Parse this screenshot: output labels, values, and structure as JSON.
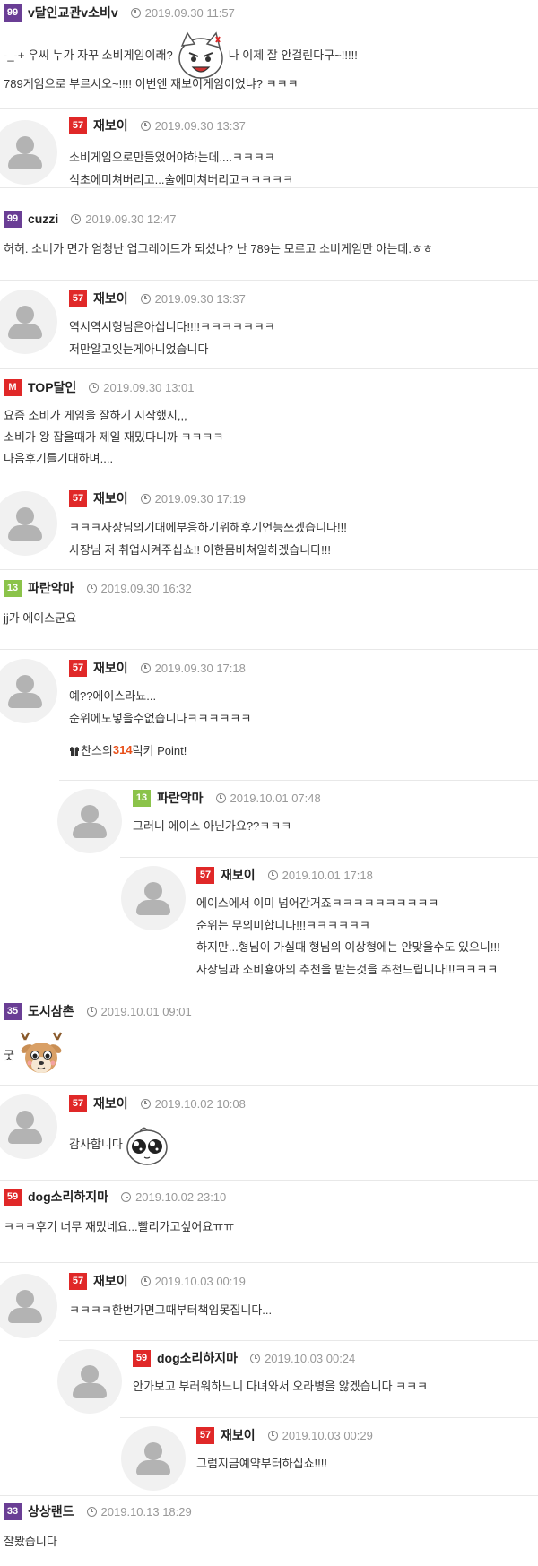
{
  "colors": {
    "purple": "#6a3e95",
    "red": "#e02828",
    "green": "#8bc34a"
  },
  "comments": [
    {
      "level": "99",
      "nick": "v달인교관v소비v",
      "date": "2019.09.30 11:57",
      "line1a": "-_-+ 우씨 누가 자꾸 소비게임이래?",
      "line1b": "나 이제 잘 안걸린다구~!!!!!",
      "line2": "789게임으로 부르시오~!!!!   이번엔 재보이게임이었냐? ㅋㅋㅋ"
    },
    {
      "level": "57",
      "nick": "재보이",
      "date": "2019.09.30 13:37",
      "lines": [
        "소비게임으로만들었어야하는데....ㅋㅋㅋㅋ",
        "식초에미쳐버리고...술에미쳐버리고ㅋㅋㅋㅋㅋ"
      ]
    },
    {
      "level": "99",
      "nick": "cuzzi",
      "date": "2019.09.30 12:47",
      "lines": [
        "허허. 소비가 면가 엄청난 업그레이드가 되셨나? 난 789는 모르고 소비게임만 아는데.ㅎㅎ"
      ]
    },
    {
      "level": "57",
      "nick": "재보이",
      "date": "2019.09.30 13:37",
      "lines": [
        "역시역시형님은아십니다!!!!ㅋㅋㅋㅋㅋㅋㅋ",
        "저만알고잇는게아니었습니다"
      ]
    },
    {
      "level": "M",
      "nick": "TOP달인",
      "date": "2019.09.30 13:01",
      "lines": [
        "요즘 소비가 게임을 잘하기 시작했지,,,",
        "소비가 왕 잡을때가 제일 재밌다니까 ㅋㅋㅋㅋ",
        "다음후기를기대하며...."
      ]
    },
    {
      "level": "57",
      "nick": "재보이",
      "date": "2019.09.30 17:19",
      "lines": [
        "ㅋㅋㅋ사장님의기대에부응하기위해후기언능쓰겠습니다!!!",
        "사장님 저 취업시켜주십쇼!! 이한몸바쳐일하겠습니다!!!"
      ]
    },
    {
      "level": "13",
      "nick": "파란악마",
      "date": "2019.09.30 16:32",
      "lines": [
        "jj가 에이스군요"
      ]
    },
    {
      "level": "57",
      "nick": "재보이",
      "date": "2019.09.30 17:18",
      "lines": [
        "예??에이스라뇨...",
        "순위에도넣을수없습니다ㅋㅋㅋㅋㅋㅋ"
      ],
      "lucky_prefix": "찬스의 ",
      "lucky_num": "314",
      "lucky_suffix": " 럭키 Point!"
    },
    {
      "level": "13",
      "nick": "파란악마",
      "date": "2019.10.01 07:48",
      "lines": [
        "그러니 에이스 아닌가요??ㅋㅋㅋ"
      ]
    },
    {
      "level": "57",
      "nick": "재보이",
      "date": "2019.10.01 17:18",
      "lines": [
        "에이스에서 이미 넘어간거죠ㅋㅋㅋㅋㅋㅋㅋㅋㅋㅋ",
        "순위는 무의미합니다!!!ㅋㅋㅋㅋㅋㅋ",
        "하지만...형님이 가실때 형님의 이상형에는 안맞을수도 있으니!!!",
        "사장님과 소비횽아의 추천을 받는것을 추천드립니다!!!ㅋㅋㅋㅋ"
      ]
    },
    {
      "level": "35",
      "nick": "도시삼촌",
      "date": "2019.10.01 09:01",
      "lines": [
        "굿"
      ]
    },
    {
      "level": "57",
      "nick": "재보이",
      "date": "2019.10.02 10:08",
      "lines": [
        "감사합니다"
      ]
    },
    {
      "level": "59",
      "nick": "dog소리하지마",
      "date": "2019.10.02 23:10",
      "lines": [
        "ㅋㅋㅋ후기 너무 재밌네요...빨리가고싶어요ㅠㅠ"
      ]
    },
    {
      "level": "57",
      "nick": "재보이",
      "date": "2019.10.03 00:19",
      "lines": [
        "ㅋㅋㅋㅋ한번가면그때부터책임못집니다..."
      ]
    },
    {
      "level": "59",
      "nick": "dog소리하지마",
      "date": "2019.10.03 00:24",
      "lines": [
        "안가보고 부러워하느니 다녀와서 오라병을 앓겠습니다 ㅋㅋㅋ"
      ]
    },
    {
      "level": "57",
      "nick": "재보이",
      "date": "2019.10.03 00:29",
      "lines": [
        "그럼지금예약부터하십쇼!!!!"
      ]
    },
    {
      "level": "33",
      "nick": "상상랜드",
      "date": "2019.10.13 18:29",
      "lines": [
        "잘봤습니다"
      ]
    }
  ]
}
